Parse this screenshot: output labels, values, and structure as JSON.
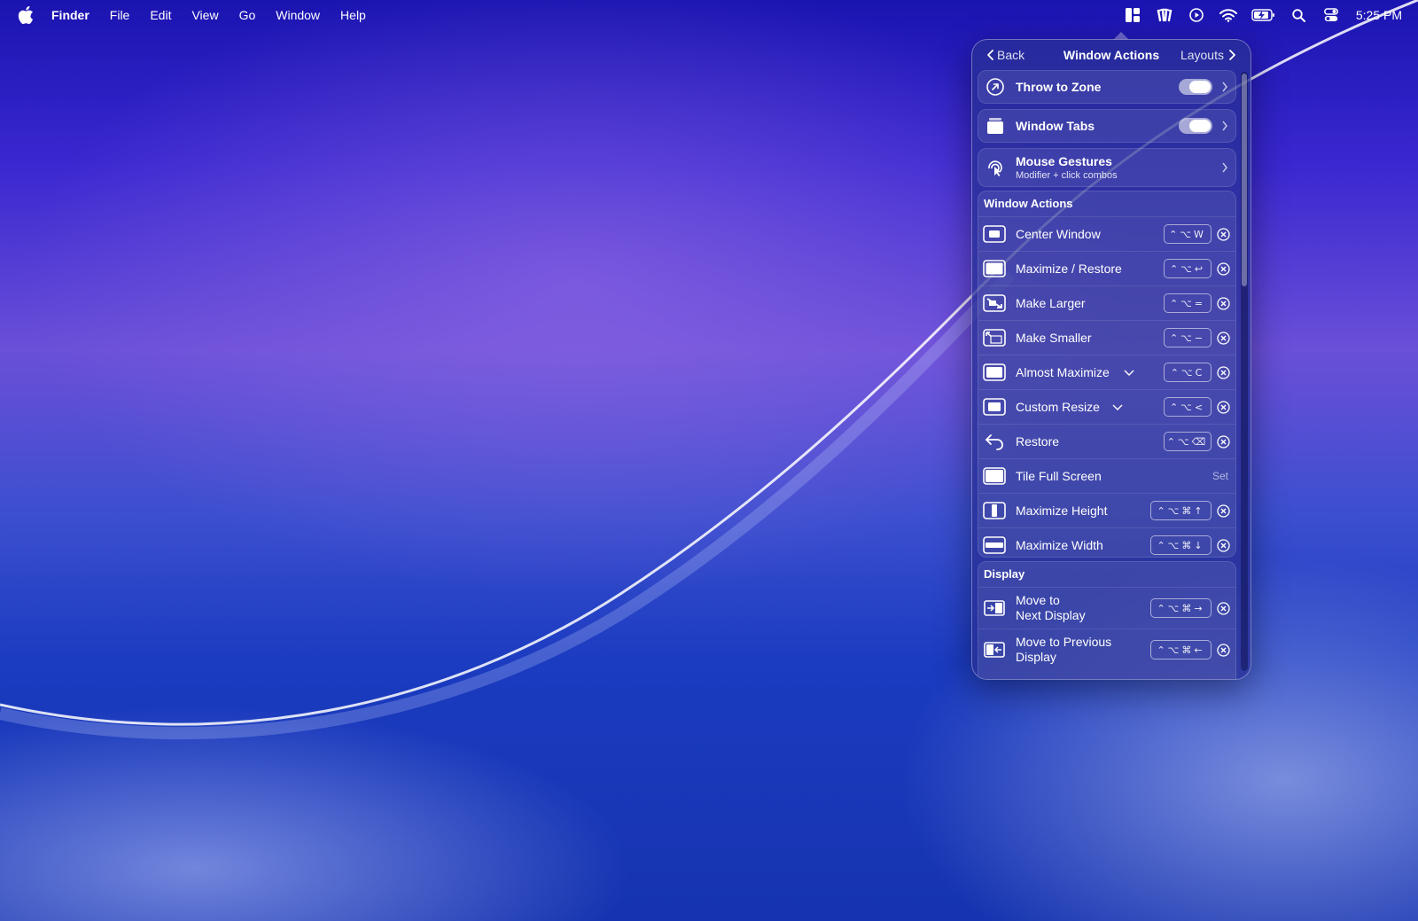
{
  "menubar": {
    "app_name": "Finder",
    "menus": [
      "File",
      "Edit",
      "View",
      "Go",
      "Window",
      "Help"
    ],
    "clock": "5:25 PM"
  },
  "panel": {
    "back_label": "Back",
    "title": "Window Actions",
    "forward_label": "Layouts",
    "features": [
      {
        "label": "Throw to Zone",
        "toggle": true
      },
      {
        "label": "Window Tabs",
        "toggle": true
      },
      {
        "label": "Mouse Gestures",
        "subtitle": "Modifier + click combos"
      }
    ],
    "window_actions": {
      "title": "Window Actions",
      "items": [
        {
          "label": "Center Window",
          "shortcut": "⌃⌥W"
        },
        {
          "label": "Maximize / Restore",
          "shortcut": "⌃⌥↩"
        },
        {
          "label": "Make Larger",
          "shortcut": "⌃⌥="
        },
        {
          "label": "Make Smaller",
          "shortcut": "⌃⌥−"
        },
        {
          "label": "Almost Maximize",
          "shortcut": "⌃⌥C"
        },
        {
          "label": "Custom Resize",
          "shortcut": "⌃⌥<"
        },
        {
          "label": "Restore",
          "shortcut": "⌃⌥⌫"
        },
        {
          "label": "Tile Full Screen",
          "set_label": "Set"
        },
        {
          "label": "Maximize Height",
          "shortcut": "⌃⌥⌘↑"
        },
        {
          "label": "Maximize Width",
          "shortcut": "⌃⌥⌘↓"
        }
      ]
    },
    "display": {
      "title": "Display",
      "items": [
        {
          "label_line1": "Move to",
          "label_line2": "Next Display",
          "shortcut": "⌃⌥⌘→"
        },
        {
          "label_line1": "Move to Previous",
          "label_line2": "Display",
          "shortcut": "⌃⌥⌘←"
        }
      ]
    }
  }
}
